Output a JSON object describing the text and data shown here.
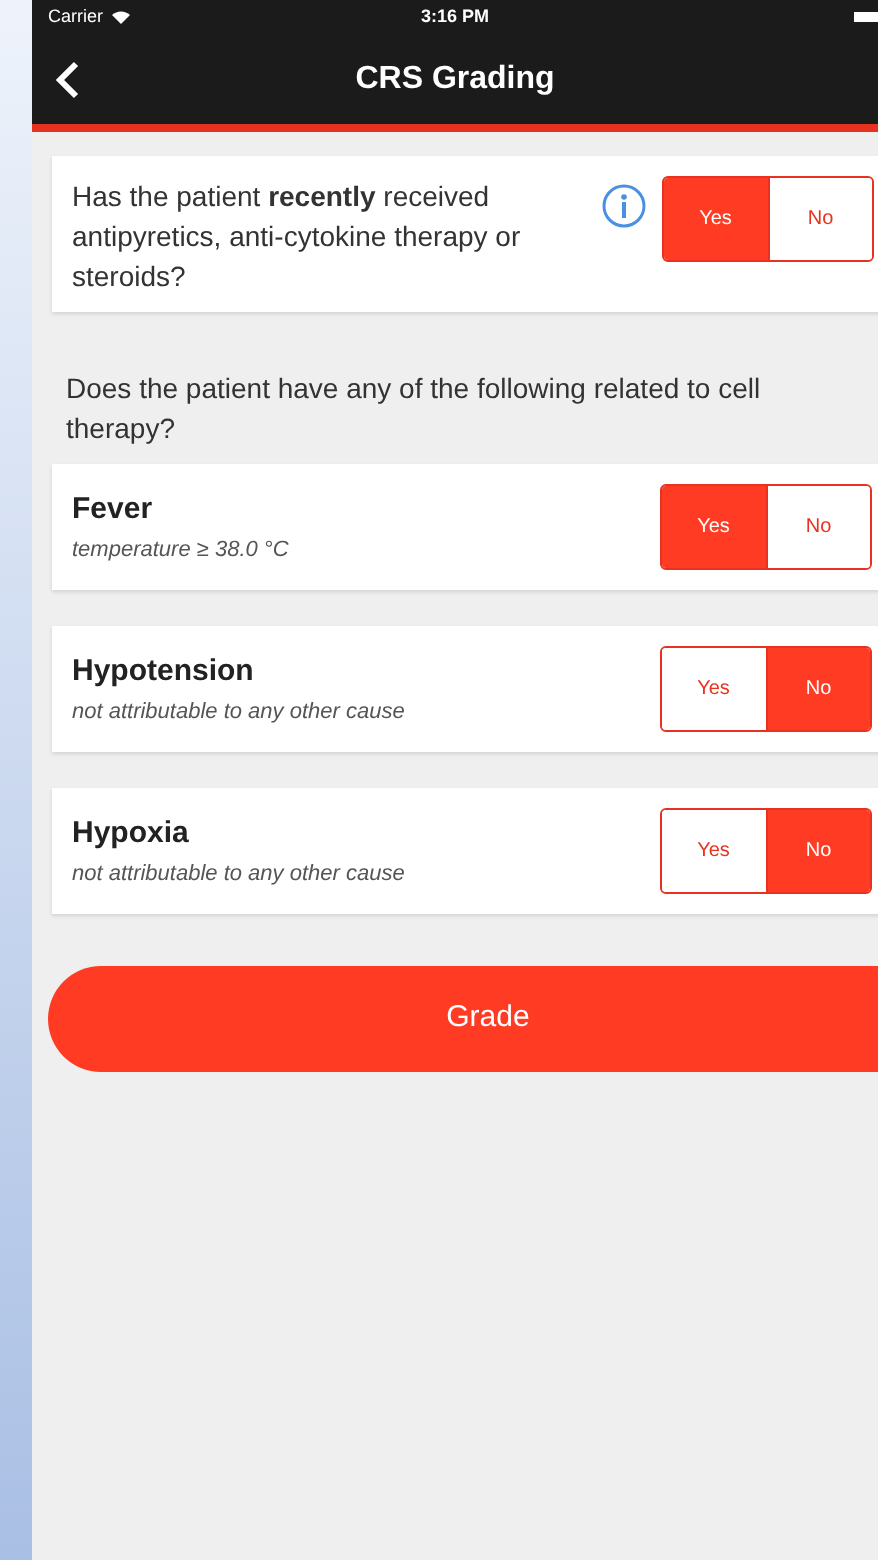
{
  "status_bar": {
    "carrier": "Carrier",
    "time": "3:16 PM"
  },
  "nav": {
    "title": "CRS Grading"
  },
  "first_question": {
    "text": "Has the patient **recently** received antipyretics, anti-cytokine therapy or steroids?",
    "options": [
      {
        "label": "Yes",
        "selected": true
      },
      {
        "label": "No",
        "selected": false
      }
    ]
  },
  "intro": "Does the patient have any of the following related to cell therapy?",
  "symptoms": [
    {
      "title": "Fever",
      "subtitle": "temperature ≥ 38.0 °C",
      "options": [
        {
          "label": "Yes",
          "selected": true
        },
        {
          "label": "No",
          "selected": false
        }
      ]
    },
    {
      "title": "Hypotension",
      "subtitle": "not attributable to any other cause",
      "options": [
        {
          "label": "Yes",
          "selected": false
        },
        {
          "label": "No",
          "selected": true
        }
      ]
    },
    {
      "title": "Hypoxia",
      "subtitle": "not attributable to any other cause",
      "options": [
        {
          "label": "Yes",
          "selected": false
        },
        {
          "label": "No",
          "selected": true
        }
      ]
    }
  ],
  "grade_button": "Grade"
}
